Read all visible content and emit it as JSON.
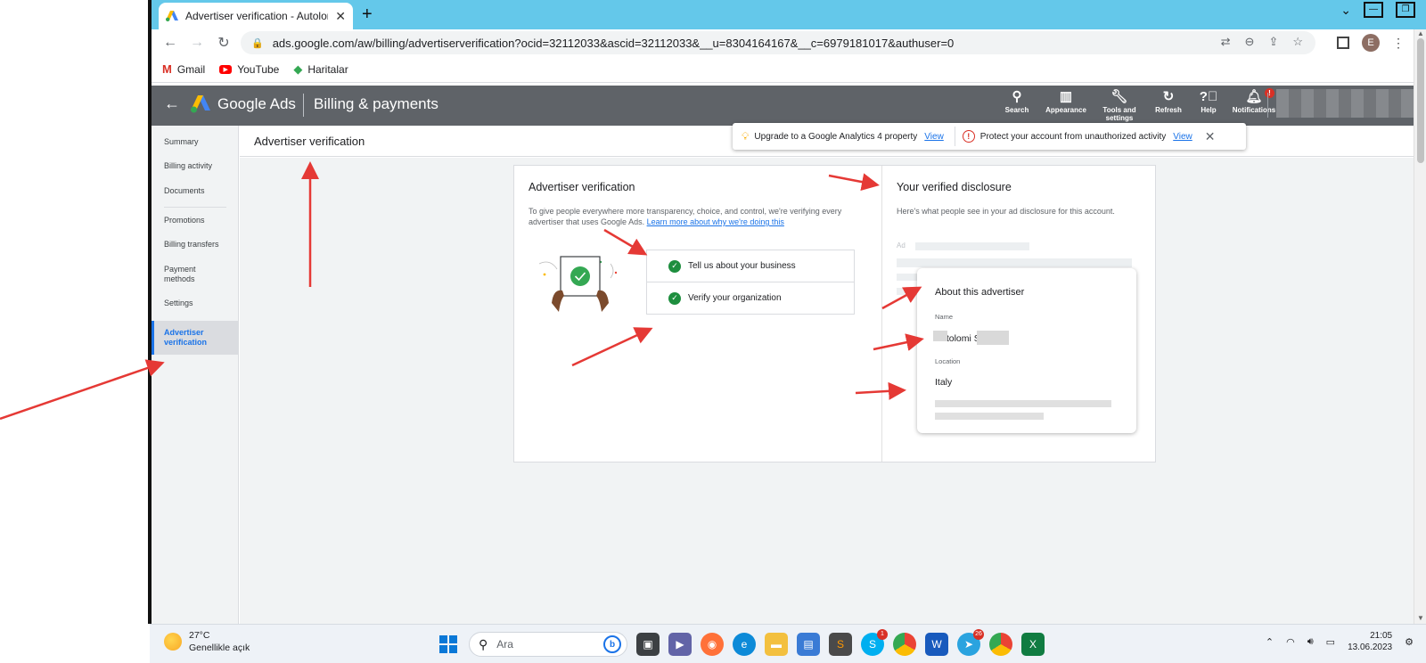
{
  "browser": {
    "tab_title": "Advertiser verification - Autolomi",
    "tab_close": "✕",
    "new_tab": "+",
    "url": "ads.google.com/aw/billing/advertiserverification?ocid=32112033&ascid=32112033&__u=8304164167&__c=6979181017&authuser=0",
    "avatar_letter": "E",
    "bookmarks": [
      "Gmail",
      "YouTube",
      "Haritalar"
    ]
  },
  "ads_header": {
    "brand": "Google Ads",
    "section": "Billing & payments",
    "actions": [
      {
        "label": "Search",
        "icon": "search-icon"
      },
      {
        "label": "Appearance",
        "icon": "appearance-icon"
      },
      {
        "label": "Tools and settings",
        "icon": "wrench-icon"
      },
      {
        "label": "Refresh",
        "icon": "refresh-icon"
      },
      {
        "label": "Help",
        "icon": "help-icon"
      },
      {
        "label": "Notifications",
        "icon": "bell-icon",
        "badge": "!"
      }
    ]
  },
  "sidebar": {
    "items": [
      "Summary",
      "Billing activity",
      "Documents",
      "Promotions",
      "Billing transfers",
      "Payment methods",
      "Settings",
      "Advertiser verification"
    ],
    "active": "Advertiser verification"
  },
  "page_title": "Advertiser verification",
  "banner": {
    "ga_text": "Upgrade to a Google Analytics 4 property",
    "ga_link": "View",
    "security_text": "Protect your account from unauthorized activity",
    "security_link": "View"
  },
  "verification": {
    "title": "Advertiser verification",
    "description": "To give people everywhere more transparency, choice, and control, we're verifying every advertiser that uses Google Ads.",
    "learn_more": "Learn more about why we're doing this",
    "steps": [
      "Tell us about your business",
      "Verify your organization"
    ]
  },
  "disclosure": {
    "title": "Your verified disclosure",
    "subtitle": "Here's what people see in your ad disclosure for this account.",
    "ad_label": "Ad",
    "about_title": "About this advertiser",
    "name_label": "Name",
    "name_value": "Autolomi Srl",
    "location_label": "Location",
    "location_value": "Italy"
  },
  "taskbar": {
    "temperature": "27°C",
    "weather": "Genellikle açık",
    "search_placeholder": "Ara",
    "time": "21:05",
    "date": "13.06.2023",
    "badges": {
      "skype": "1",
      "telegram": "26"
    }
  },
  "colors": {
    "accent": "#1a73e8",
    "header_bg": "#5f6368",
    "success": "#1e8e3e",
    "arrow": "#e53935",
    "tab_strip": "#64c8ea"
  }
}
